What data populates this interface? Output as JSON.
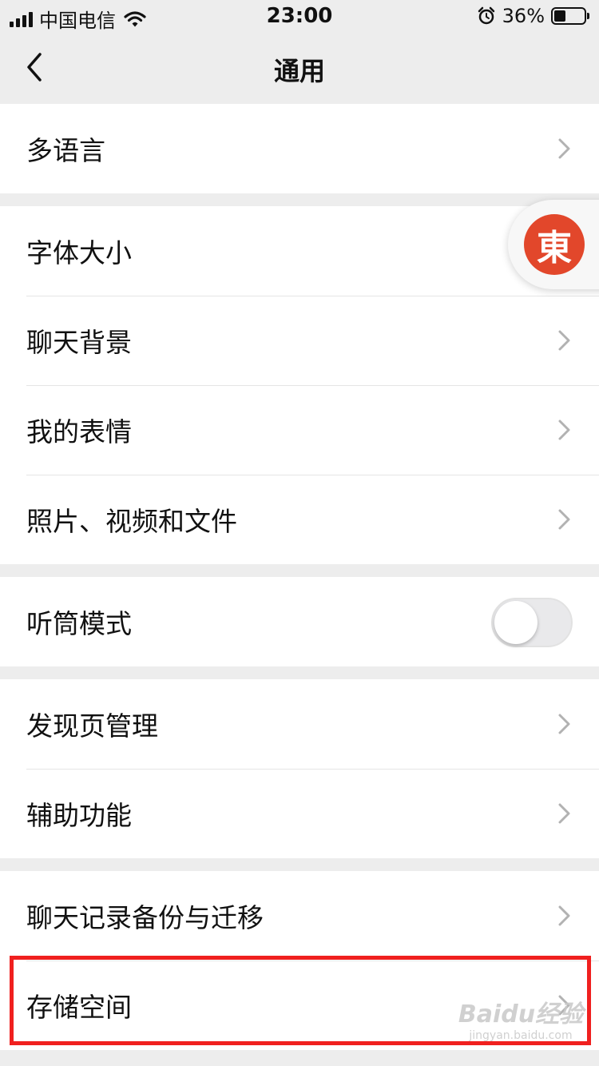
{
  "status_bar": {
    "carrier": "中国电信",
    "time": "23:00",
    "battery_percent": "36%",
    "icons": [
      "signal-icon",
      "wifi-icon",
      "alarm-icon",
      "battery-icon"
    ]
  },
  "nav": {
    "title": "通用",
    "back_icon": "chevron-left-icon"
  },
  "groups": [
    {
      "items": [
        {
          "label": "多语言",
          "type": "link"
        }
      ]
    },
    {
      "items": [
        {
          "label": "字体大小",
          "type": "link"
        },
        {
          "label": "聊天背景",
          "type": "link"
        },
        {
          "label": "我的表情",
          "type": "link"
        },
        {
          "label": "照片、视频和文件",
          "type": "link"
        }
      ]
    },
    {
      "items": [
        {
          "label": "听筒模式",
          "type": "toggle",
          "on": false
        }
      ]
    },
    {
      "items": [
        {
          "label": "发现页管理",
          "type": "link"
        },
        {
          "label": "辅助功能",
          "type": "link"
        }
      ]
    },
    {
      "items": [
        {
          "label": "聊天记录备份与迁移",
          "type": "link"
        },
        {
          "label": "存储空间",
          "type": "link",
          "highlighted": true
        }
      ]
    }
  ],
  "floating_badge": {
    "glyph": "東"
  },
  "watermark": {
    "brand": "Baidu经验",
    "url": "jingyan.baidu.com"
  },
  "colors": {
    "background": "#ededed",
    "cell": "#ffffff",
    "highlight": "#f0201f",
    "badge": "#e2472b"
  }
}
